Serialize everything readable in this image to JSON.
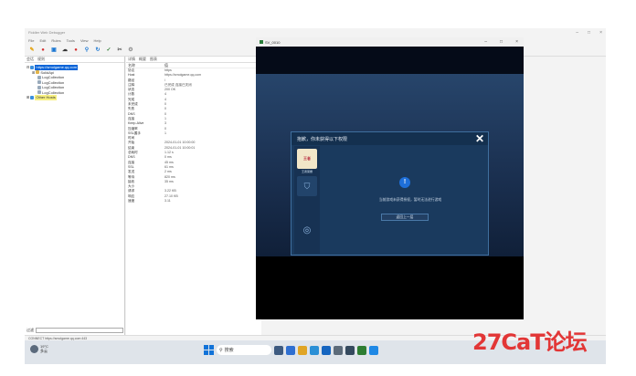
{
  "app": {
    "title": "Fiddler Web Debugger",
    "menu": [
      "File",
      "Edit",
      "Rules",
      "Tools",
      "View",
      "Help"
    ],
    "left_tabs": [
      "会话",
      "规则"
    ],
    "tree": [
      {
        "label": "https://smolgame.qq.com",
        "selected": true
      },
      {
        "label": "SolidApi"
      },
      {
        "label": "LogCollection"
      },
      {
        "label": "LogCollection"
      },
      {
        "label": "LogCollection"
      },
      {
        "label": "LogCollection"
      },
      {
        "label": "Other Hosts",
        "highlight": true
      }
    ],
    "filter_label": "过滤",
    "mid_tabs": [
      "详情",
      "概要",
      "图表"
    ],
    "prop_headers": [
      "名称",
      "值"
    ],
    "props": [
      {
        "k": "协议",
        "v": "https"
      },
      {
        "k": "Host",
        "v": "https://smolgame.qq.com"
      },
      {
        "k": "路径",
        "v": "/"
      },
      {
        "k": "注释",
        "v": "已完成 连接已关闭"
      },
      {
        "k": "状态",
        "v": "200 OK"
      },
      {
        "k": "计数",
        "v": "4"
      },
      {
        "k": "完成",
        "v": "4"
      },
      {
        "k": "未完成",
        "v": "0"
      },
      {
        "k": "失败",
        "v": "0"
      },
      {
        "k": "DNS",
        "v": "0"
      },
      {
        "k": "连接",
        "v": "1"
      },
      {
        "k": "Keep-Alive",
        "v": "3"
      },
      {
        "k": "压缩率",
        "v": "0"
      },
      {
        "k": "SSL握手",
        "v": "1"
      },
      {
        "k": "时间",
        "v": ""
      },
      {
        "k": "开始",
        "v": "2024-01-01 10:00:00"
      },
      {
        "k": "结束",
        "v": "2024-01-01 10:00:01"
      },
      {
        "k": "总耗时",
        "v": "1.12 s"
      },
      {
        "k": "DNS",
        "v": "0 ms"
      },
      {
        "k": "连接",
        "v": "45 ms"
      },
      {
        "k": "SSL",
        "v": "61 ms"
      },
      {
        "k": "发送",
        "v": "2 ms"
      },
      {
        "k": "等待",
        "v": "820 ms"
      },
      {
        "k": "接收",
        "v": "35 ms"
      },
      {
        "k": "大小",
        "v": ""
      },
      {
        "k": "请求",
        "v": "3.22 KB"
      },
      {
        "k": "响应",
        "v": "27.10 KB"
      },
      {
        "k": "速度",
        "v": "3.11"
      }
    ],
    "status_text": "CONNECT https://smolgame.qq.com:443"
  },
  "phone": {
    "title": "SV_0010",
    "dialog": {
      "title": "抱歉，你未获得以下权限",
      "side_label": "王者荣耀",
      "side_logo": "王者",
      "message": "当前游戏未获得授权，暂时无法进行游戏",
      "button": "返回上一层"
    }
  },
  "taskbar": {
    "weather_temp": "19°C",
    "weather_desc": "多云",
    "search_placeholder": "搜索"
  },
  "watermark": "27CaT论坛",
  "colors": {
    "accent": "#0a64d8",
    "dialog_bg": "#1a3a5e",
    "watermark": "#e23636"
  }
}
